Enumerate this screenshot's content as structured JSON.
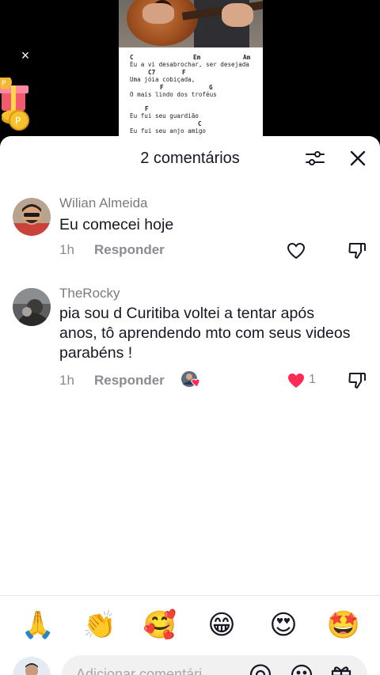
{
  "video": {
    "sheet_lines": [
      {
        "type": "chords",
        "items": [
          {
            "text": "C",
            "pos": 0
          },
          {
            "text": "Em",
            "pos": 80
          },
          {
            "text": "Am",
            "pos": 143
          }
        ]
      },
      {
        "type": "lyric",
        "text": "Eu a vi desabrochar, ser desejada"
      },
      {
        "type": "chords",
        "items": [
          {
            "text": "C7",
            "pos": 23
          },
          {
            "text": "F",
            "pos": 66
          }
        ]
      },
      {
        "type": "lyric",
        "text": "Uma jóia cobiçada,"
      },
      {
        "type": "chords",
        "items": [
          {
            "text": "F",
            "pos": 38
          },
          {
            "text": "G",
            "pos": 100
          }
        ]
      },
      {
        "type": "lyric",
        "text": "O mais lindo dos troféus"
      },
      {
        "type": "gap"
      },
      {
        "type": "chords",
        "items": [
          {
            "text": "F",
            "pos": 19
          }
        ]
      },
      {
        "type": "lyric",
        "text": "Eu fui seu guardião"
      },
      {
        "type": "chords",
        "items": [
          {
            "text": "C",
            "pos": 86
          }
        ]
      },
      {
        "type": "lyric",
        "text": "Eu fui seu anjo amigo"
      }
    ]
  },
  "panel": {
    "title": "2 comentários"
  },
  "comments": [
    {
      "username": "Wilian Almeida",
      "text": "Eu comecei hoje",
      "time": "1h",
      "reply_label": "Responder",
      "likes": "",
      "liked": false
    },
    {
      "username": "TheRocky",
      "text": "pia sou d Curitiba voltei a tentar após anos, tô aprendendo mto com seus videos parabéns !",
      "time": "1h",
      "reply_label": "Responder",
      "likes": "1",
      "liked": true,
      "creator_liked": true
    }
  ],
  "emojis": [
    {
      "name": "praying-hands-emoji",
      "glyph": "🙏"
    },
    {
      "name": "clapping-hands-emoji",
      "glyph": "👏"
    },
    {
      "name": "smiling-face-with-hearts-emoji",
      "glyph": "🥰"
    },
    {
      "name": "grinning-face-emoji",
      "glyph": "😁"
    },
    {
      "name": "heart-eyes-emoji",
      "glyph": "😍"
    },
    {
      "name": "star-struck-emoji",
      "glyph": "🤩"
    }
  ],
  "input": {
    "placeholder": "Adicionar comentári..."
  },
  "colors": {
    "like_red": "#fe2c55",
    "text_primary": "#161823",
    "text_secondary": "#8a8b91"
  },
  "icons": {
    "close_video": "close-icon",
    "filter": "sliders-icon",
    "close_panel": "close-icon",
    "like": "heart-icon",
    "dislike": "thumbs-down-icon",
    "mention": "at-icon",
    "emoji": "smiley-icon",
    "gift": "gift-icon"
  }
}
